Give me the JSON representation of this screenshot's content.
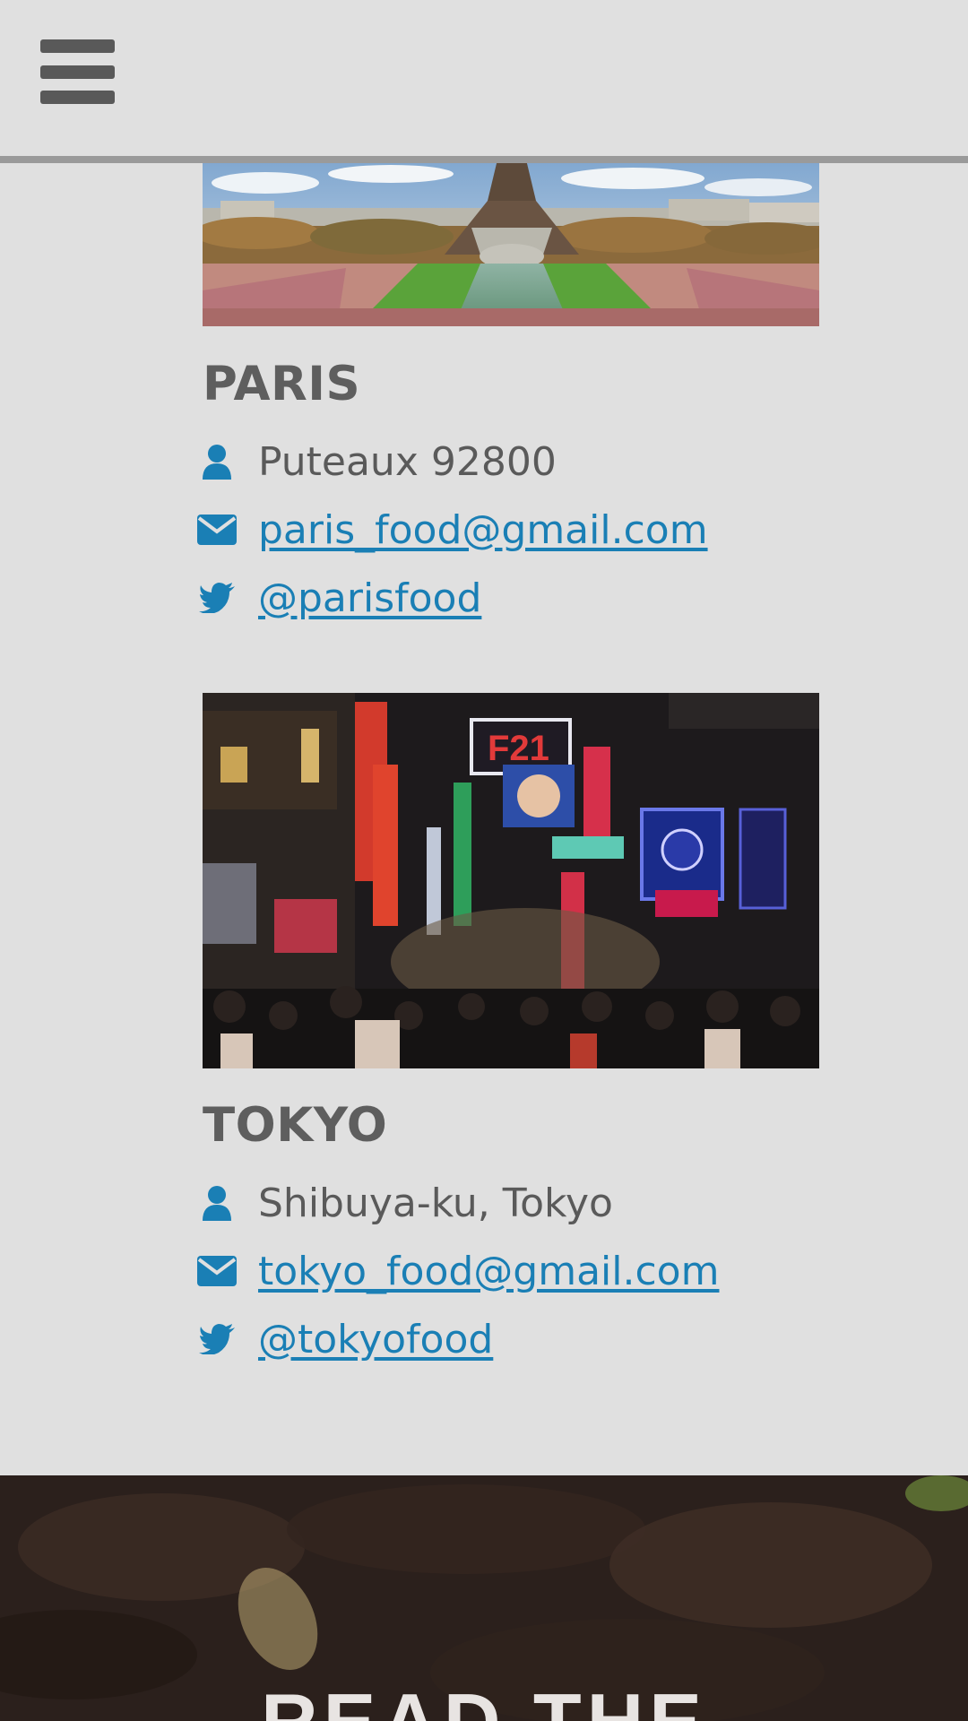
{
  "header": {
    "menu_icon": "hamburger-menu-icon"
  },
  "locations": [
    {
      "city": "PARIS",
      "image_alt": "Eiffel Tower seen from the Trocadéro gardens",
      "address": "Puteaux 92800",
      "email": "paris_food@gmail.com",
      "twitter": "@parisfood"
    },
    {
      "city": "TOKYO",
      "image_alt": "Neon-lit crowded street in Shibuya at night",
      "address": "Shibuya-ku, Tokyo",
      "email": "tokyo_food@gmail.com",
      "twitter": "@tokyofood"
    }
  ],
  "icons": {
    "address": "user-icon",
    "email": "envelope-icon",
    "twitter": "twitter-icon"
  },
  "banner": {
    "title": "READ THE"
  },
  "colors": {
    "background": "#e0e0e0",
    "link": "#1a7fb5",
    "icon": "#1a7fb5",
    "heading": "#5e5e5e",
    "text": "#5a5a5a"
  }
}
